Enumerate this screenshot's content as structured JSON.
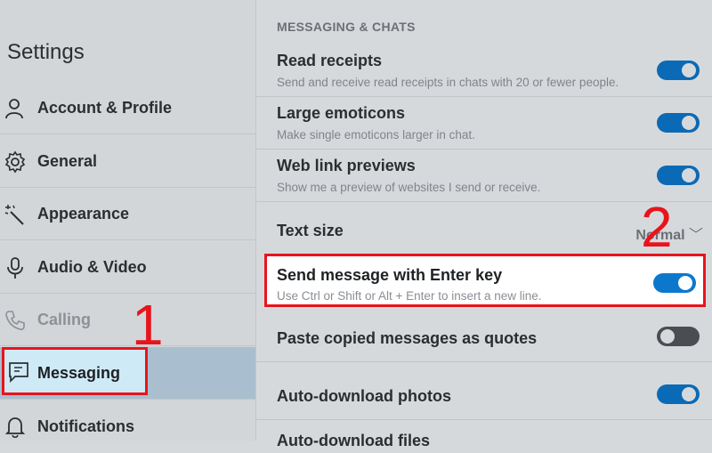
{
  "sidebar": {
    "title": "Settings",
    "items": [
      {
        "label": "Account & Profile",
        "icon": "person-icon"
      },
      {
        "label": "General",
        "icon": "gear-icon"
      },
      {
        "label": "Appearance",
        "icon": "magic-wand-icon"
      },
      {
        "label": "Audio & Video",
        "icon": "microphone-icon"
      },
      {
        "label": "Calling",
        "icon": "phone-icon"
      },
      {
        "label": "Messaging",
        "icon": "chat-icon"
      },
      {
        "label": "Notifications",
        "icon": "bell-icon"
      }
    ]
  },
  "main": {
    "section_title": "MESSAGING & CHATS",
    "settings": [
      {
        "title": "Read receipts",
        "desc": "Send and receive read receipts in chats with 20 or fewer people.",
        "toggle": "on"
      },
      {
        "title": "Large emoticons",
        "desc": "Make single emoticons larger in chat.",
        "toggle": "on"
      },
      {
        "title": "Web link previews",
        "desc": "Show me a preview of websites I send or receive.",
        "toggle": "on"
      },
      {
        "title": "Text size",
        "value": "Normal"
      },
      {
        "title": "Send message with Enter key",
        "desc": "Use Ctrl or Shift or Alt + Enter to insert a new line.",
        "toggle": "on"
      },
      {
        "title": "Paste copied messages as quotes",
        "toggle": "off"
      },
      {
        "title": "Auto-download photos",
        "toggle": "on"
      },
      {
        "title": "Auto-download files"
      }
    ]
  },
  "annotations": {
    "step1": "1",
    "step2": "2"
  },
  "colors": {
    "accent": "#0c78cc",
    "highlight": "#e8141c"
  }
}
